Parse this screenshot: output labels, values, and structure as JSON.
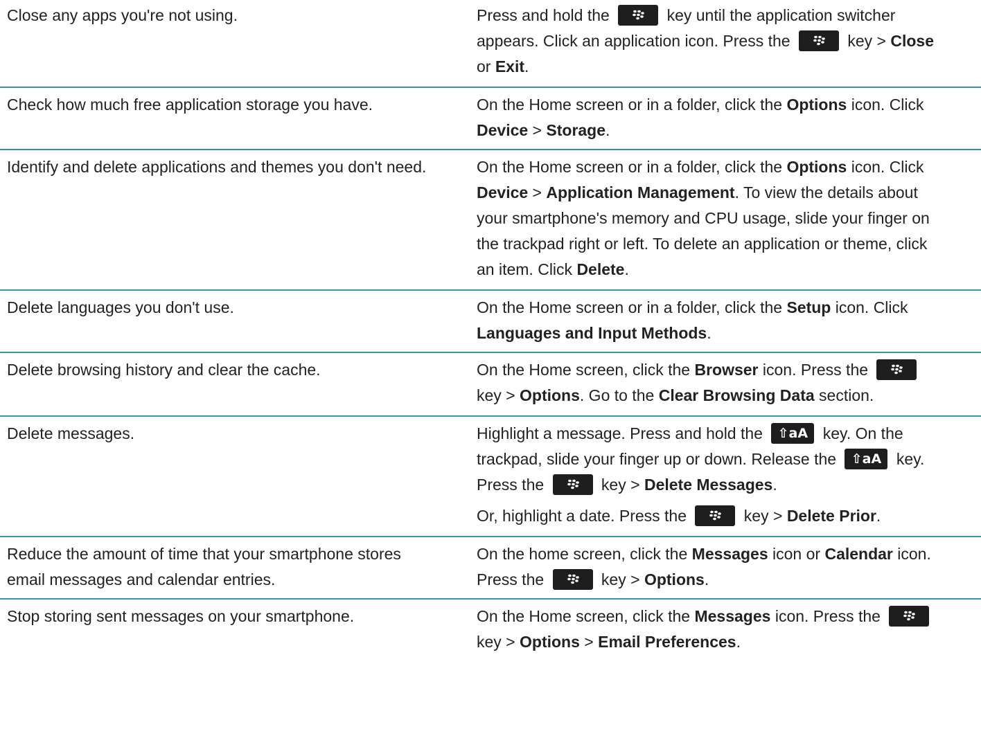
{
  "rows": [
    {
      "left": "Close any apps you're not using.",
      "right": [
        [
          {
            "t": "Press and hold the "
          },
          {
            "k": "menu"
          },
          {
            "t": " key until the application switcher appears. Click an application icon. Press the "
          },
          {
            "k": "menu"
          },
          {
            "t": " key > "
          },
          {
            "b": "Close"
          },
          {
            "t": " or "
          },
          {
            "b": "Exit"
          },
          {
            "t": "."
          }
        ]
      ]
    },
    {
      "left": "Check how much free application storage you have.",
      "right": [
        [
          {
            "t": "On the Home screen or in a folder, click the "
          },
          {
            "b": "Options"
          },
          {
            "t": " icon. Click "
          },
          {
            "b": "Device"
          },
          {
            "t": " > "
          },
          {
            "b": "Storage"
          },
          {
            "t": "."
          }
        ]
      ]
    },
    {
      "left": "Identify and delete applications and themes you don't need.",
      "right": [
        [
          {
            "t": "On the Home screen or in a folder, click the "
          },
          {
            "b": "Options"
          },
          {
            "t": " icon. Click "
          },
          {
            "b": "Device"
          },
          {
            "t": " > "
          },
          {
            "b": "Application Management"
          },
          {
            "t": ". To view the details about your smartphone's memory and CPU usage, slide your finger on the trackpad right or left. To delete an application or theme, click an item. Click "
          },
          {
            "b": "Delete"
          },
          {
            "t": "."
          }
        ]
      ]
    },
    {
      "left": "Delete languages you don't use.",
      "right": [
        [
          {
            "t": "On the Home screen or in a folder, click the "
          },
          {
            "b": "Setup"
          },
          {
            "t": " icon. Click "
          },
          {
            "b": "Languages and Input Methods"
          },
          {
            "t": "."
          }
        ]
      ]
    },
    {
      "left": "Delete browsing history and clear the cache.",
      "right": [
        [
          {
            "t": "On the Home screen, click the "
          },
          {
            "b": "Browser"
          },
          {
            "t": " icon. Press the "
          },
          {
            "k": "menu"
          },
          {
            "t": " key > "
          },
          {
            "b": "Options"
          },
          {
            "t": ". Go to the "
          },
          {
            "b": "Clear Browsing Data"
          },
          {
            "t": " section."
          }
        ]
      ]
    },
    {
      "left": "Delete messages.",
      "right": [
        [
          {
            "t": "Highlight a message. Press and hold the "
          },
          {
            "k": "shift"
          },
          {
            "t": " key. On the trackpad, slide your finger up or down. Release the "
          },
          {
            "k": "shift"
          },
          {
            "t": " key. Press the "
          },
          {
            "k": "menu"
          },
          {
            "t": " key > "
          },
          {
            "b": "Delete Messages"
          },
          {
            "t": "."
          }
        ],
        [
          {
            "t": "Or, highlight a date. Press the "
          },
          {
            "k": "menu"
          },
          {
            "t": " key > "
          },
          {
            "b": "Delete Prior"
          },
          {
            "t": "."
          }
        ]
      ]
    },
    {
      "left": "Reduce the amount of time that your smartphone stores email messages and calendar entries.",
      "right": [
        [
          {
            "t": "On the home screen, click the "
          },
          {
            "b": "Messages"
          },
          {
            "t": " icon or "
          },
          {
            "b": "Calendar"
          },
          {
            "t": " icon. Press the "
          },
          {
            "k": "menu"
          },
          {
            "t": " key > "
          },
          {
            "b": "Options"
          },
          {
            "t": "."
          }
        ]
      ]
    },
    {
      "left": "Stop storing sent messages on your smartphone.",
      "right": [
        [
          {
            "t": "On the Home screen, click the "
          },
          {
            "b": "Messages"
          },
          {
            "t": " icon. Press the "
          },
          {
            "k": "menu"
          },
          {
            "t": " key > "
          },
          {
            "b": "Options"
          },
          {
            "t": " > "
          },
          {
            "b": "Email Preferences"
          },
          {
            "t": "."
          }
        ]
      ]
    }
  ],
  "keys": {
    "menu": {
      "icon": "blackberry-menu-key-icon"
    },
    "shift": {
      "icon": "shift-alt-key-icon",
      "label": "⇧aA"
    }
  },
  "colors": {
    "divider": "#3a8fb0",
    "text": "#222222",
    "key_background": "#1e1e1e"
  }
}
